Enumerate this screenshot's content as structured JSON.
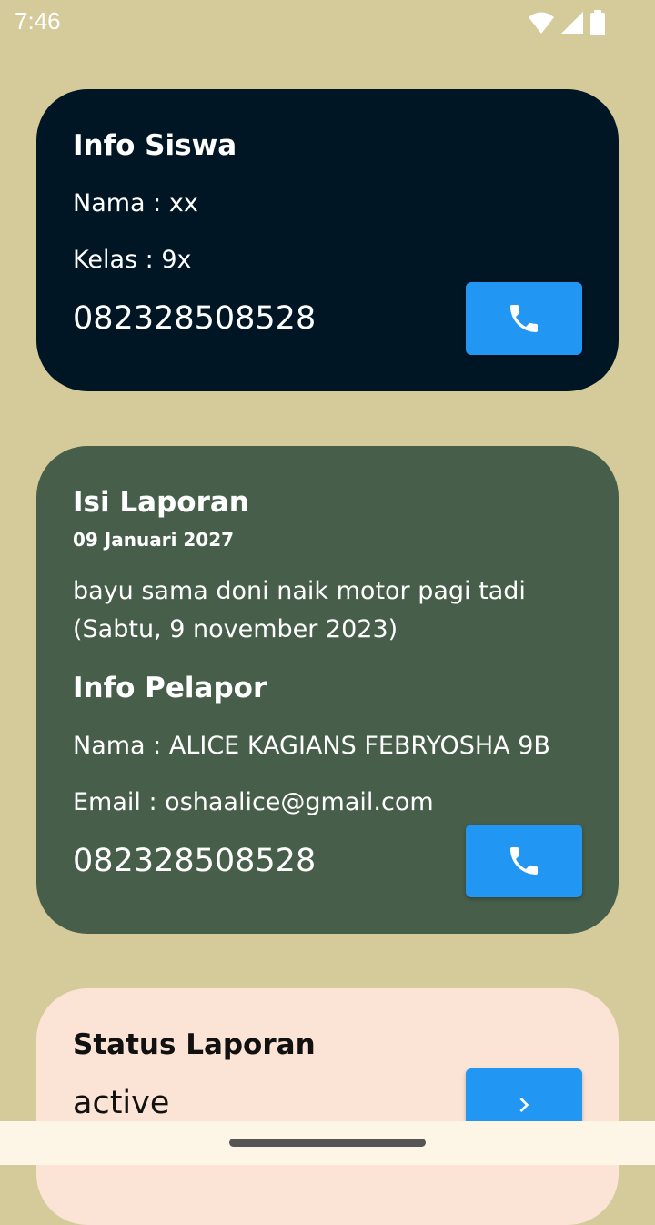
{
  "status_bar": {
    "time": "7:46",
    "icons": [
      "wifi-icon",
      "cell-signal-icon",
      "battery-icon"
    ]
  },
  "info_siswa": {
    "title": "Info Siswa",
    "nama": "Nama : xx",
    "kelas": "Kelas : 9x",
    "phone": "082328508528",
    "call_icon": "phone-icon"
  },
  "laporan": {
    "title": "Isi Laporan",
    "date": "09 Januari 2027",
    "content": "bayu sama doni naik motor pagi tadi (Sabtu, 9 november 2023)",
    "pelapor_title": "Info Pelapor",
    "pelapor_nama": "Nama : ALICE KAGIANS FEBRYOSHA 9B",
    "pelapor_email": "Email : oshaalice@gmail.com",
    "pelapor_phone": "082328508528",
    "call_icon": "phone-icon"
  },
  "status": {
    "title": "Status Laporan",
    "value": "active",
    "action_icon": "chevron-right-icon"
  },
  "colors": {
    "background": "#d5cb9a",
    "card_siswa": "#011624",
    "card_laporan": "#465e4a",
    "card_status": "#fbe3d5",
    "button": "#2196f3",
    "nav_bar": "#fdf6e6"
  }
}
